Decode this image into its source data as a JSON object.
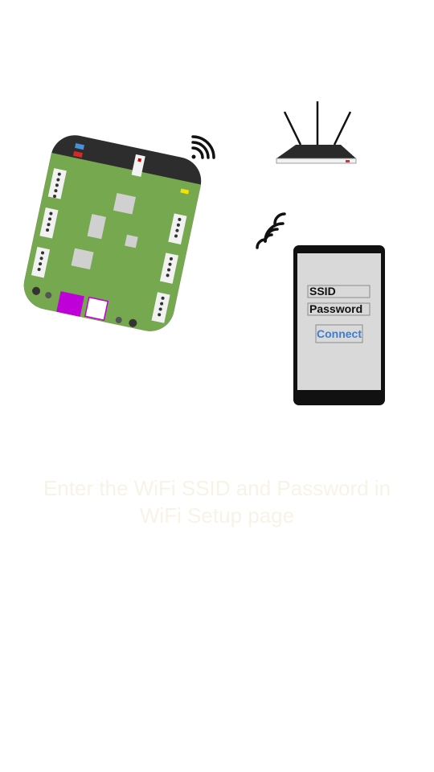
{
  "phone_form": {
    "ssid_label": "SSID",
    "password_label": "Password",
    "connect_label": "Connect"
  },
  "caption": {
    "line1": "Enter the WiFi SSID and Password in",
    "line2": "WiFi Setup page"
  },
  "colors": {
    "pcb_green": "#76a84f",
    "pcb_dark": "#2d2d2d",
    "usb_magenta": "#c000d8",
    "link_blue": "#3b7dd8",
    "phone_screen": "#d9d9d9",
    "router_led": "#d23232"
  },
  "icons": [
    "wifi-signal-icon",
    "wifi-signal-icon"
  ]
}
